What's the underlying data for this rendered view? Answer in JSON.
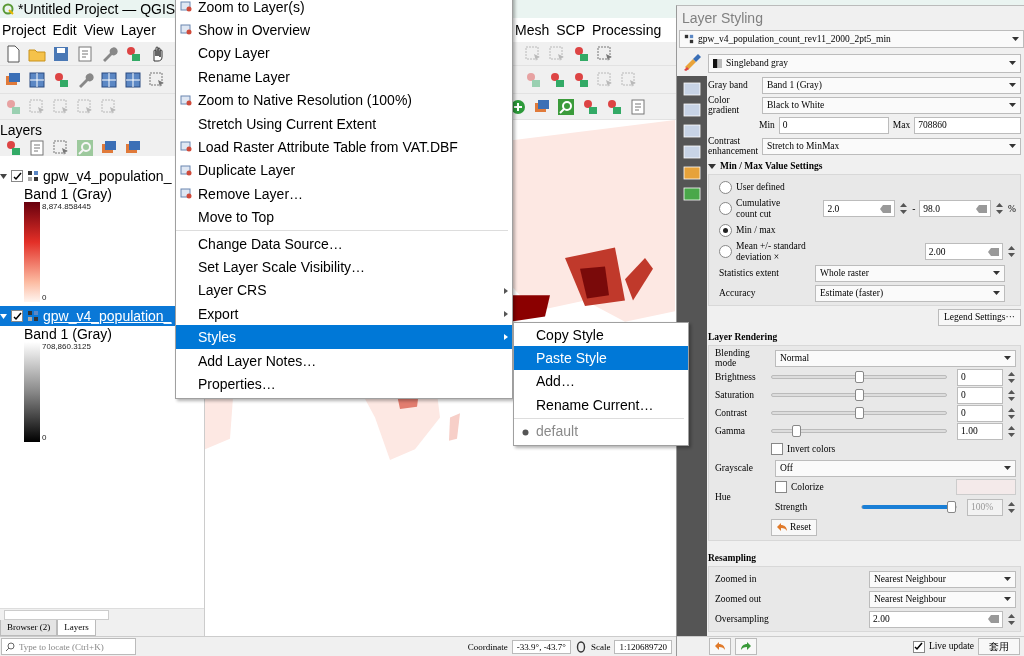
{
  "window": {
    "title": "*Untitled Project — QGIS"
  },
  "menubar": {
    "left": [
      "Project",
      "Edit",
      "View",
      "Layer"
    ],
    "right": [
      "Mesh",
      "SCP",
      "Processing"
    ]
  },
  "layers_panel": {
    "title": "Layers",
    "layers": [
      {
        "name": "gpw_v4_population_",
        "checked": true,
        "selected": false,
        "band": "Band 1 (Gray)",
        "max": "8,874.858445",
        "min": "0",
        "kind": "reds"
      },
      {
        "name": "gpw_v4_population_",
        "checked": true,
        "selected": true,
        "band": "Band 1 (Gray)",
        "max": "708,860.3125",
        "min": "0",
        "kind": "grays"
      }
    ],
    "tabs": [
      {
        "label": "Browser (2)",
        "selected": false
      },
      {
        "label": "Layers",
        "selected": true
      }
    ]
  },
  "locator": {
    "placeholder": "Type to locate (Ctrl+K)"
  },
  "status_bar": {
    "coordinate_label": "Coordinate",
    "coordinate": "-33.9°, -43.7°",
    "scale_label": "Scale",
    "scale": "1:120689720"
  },
  "context_menu": {
    "items": [
      {
        "kind": "item",
        "label": "Zoom to Layer(s)",
        "has_icon": true,
        "submenu": false,
        "selected": false
      },
      {
        "kind": "item",
        "label": "Show in Overview",
        "has_icon": true,
        "submenu": false,
        "selected": false
      },
      {
        "kind": "item",
        "label": "Copy Layer",
        "has_icon": false,
        "submenu": false,
        "selected": false
      },
      {
        "kind": "item",
        "label": "Rename Layer",
        "has_icon": false,
        "submenu": false,
        "selected": false
      },
      {
        "kind": "item",
        "label": "Zoom to Native Resolution (100%)",
        "has_icon": true,
        "submenu": false,
        "selected": false
      },
      {
        "kind": "item",
        "label": "Stretch Using Current Extent",
        "has_icon": false,
        "submenu": false,
        "selected": false
      },
      {
        "kind": "item",
        "label": "Load Raster Attribute Table from VAT.DBF",
        "has_icon": true,
        "submenu": false,
        "selected": false
      },
      {
        "kind": "item",
        "label": "Duplicate Layer",
        "has_icon": true,
        "submenu": false,
        "selected": false
      },
      {
        "kind": "item",
        "label": "Remove Layer…",
        "has_icon": true,
        "submenu": false,
        "selected": false
      },
      {
        "kind": "item",
        "label": "Move to Top",
        "has_icon": false,
        "submenu": false,
        "selected": false
      },
      {
        "kind": "separator"
      },
      {
        "kind": "item",
        "label": "Change Data Source…",
        "has_icon": false,
        "submenu": false,
        "selected": false
      },
      {
        "kind": "item",
        "label": "Set Layer Scale Visibility…",
        "has_icon": false,
        "submenu": false,
        "selected": false
      },
      {
        "kind": "item",
        "label": "Layer CRS",
        "has_icon": false,
        "submenu": true,
        "selected": false
      },
      {
        "kind": "item",
        "label": "Export",
        "has_icon": false,
        "submenu": true,
        "selected": false
      },
      {
        "kind": "item",
        "label": "Styles",
        "has_icon": false,
        "submenu": true,
        "selected": true
      },
      {
        "kind": "item",
        "label": "Add Layer Notes…",
        "has_icon": false,
        "submenu": false,
        "selected": false
      },
      {
        "kind": "item",
        "label": "Properties…",
        "has_icon": false,
        "submenu": false,
        "selected": false
      }
    ]
  },
  "styles_submenu": {
    "items": [
      {
        "kind": "item",
        "label": "Copy Style",
        "selected": false,
        "checked": false,
        "disabled": false
      },
      {
        "kind": "item",
        "label": "Paste Style",
        "selected": true,
        "checked": false,
        "disabled": false
      },
      {
        "kind": "item",
        "label": "Add…",
        "selected": false,
        "checked": false,
        "disabled": false
      },
      {
        "kind": "item",
        "label": "Rename Current…",
        "selected": false,
        "checked": false,
        "disabled": false
      },
      {
        "kind": "separator"
      },
      {
        "kind": "item",
        "label": "default",
        "selected": false,
        "checked": true,
        "disabled": true
      }
    ]
  },
  "layer_styling": {
    "title": "Layer Styling",
    "layer": "gpw_v4_population_count_rev11_2000_2pt5_min",
    "renderer": "Singleband gray",
    "gray_band": {
      "label": "Gray band",
      "value": "Band 1 (Gray)"
    },
    "color_gradient": {
      "label": "Color gradient",
      "value": "Black to White"
    },
    "min": {
      "label": "Min",
      "value": "0"
    },
    "max": {
      "label": "Max",
      "value": "708860"
    },
    "contrast": {
      "label": "Contrast enhancement",
      "value": "Stretch to MinMax"
    },
    "minmax_section": {
      "title": "Min / Max Value Settings",
      "expanded": true,
      "options": [
        {
          "label": "User defined",
          "selected": false
        },
        {
          "label": "Cumulative count cut",
          "selected": false,
          "from": "2.0",
          "range_separator": "-",
          "to": "98.0",
          "unit": "%"
        },
        {
          "label": "Min / max",
          "selected": true
        },
        {
          "label": "Mean +/- standard deviation ×",
          "selected": false,
          "value": "2.00"
        }
      ],
      "statistics_extent": {
        "label": "Statistics extent",
        "value": "Whole raster"
      },
      "accuracy": {
        "label": "Accuracy",
        "value": "Estimate (faster)"
      }
    },
    "legend_button": "Legend Settings···",
    "rendering": {
      "title": "Layer Rendering",
      "blending": {
        "label": "Blending mode",
        "value": "Normal"
      },
      "sliders": [
        {
          "label": "Brightness",
          "value": "0",
          "level": 0.5
        },
        {
          "label": "Saturation",
          "value": "0",
          "level": 0.5
        },
        {
          "label": "Contrast",
          "value": "0",
          "level": 0.5
        },
        {
          "label": "Gamma",
          "value": "1.00",
          "level": 0.12
        }
      ],
      "invert": {
        "label": "Invert colors",
        "checked": false
      },
      "grayscale": {
        "label": "Grayscale",
        "value": "Off"
      },
      "hue": {
        "label": "Hue",
        "colorize_label": "Colorize",
        "colorize": false,
        "strength_label": "Strength",
        "strength": "100%",
        "level": 1
      },
      "reset": "Reset"
    },
    "resampling": {
      "title": "Resampling",
      "zoomed_in": {
        "label": "Zoomed in",
        "value": "Nearest Neighbour"
      },
      "zoomed_out": {
        "label": "Zoomed out",
        "value": "Nearest Neighbour"
      },
      "oversampling": {
        "label": "Oversampling",
        "value": "2.00"
      }
    },
    "live_update": {
      "label": "Live update",
      "checked": true
    },
    "apply": "套用"
  }
}
